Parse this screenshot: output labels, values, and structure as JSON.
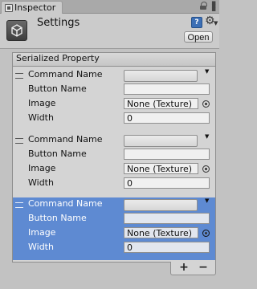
{
  "tab": {
    "title": "Inspector",
    "icon": "inspector-icon"
  },
  "header": {
    "title": "Settings",
    "icon": "settings-asset-icon",
    "help_icon": "help-icon",
    "help_glyph": "?",
    "gear_icon": "gear-icon",
    "open_button": "Open"
  },
  "list": {
    "header": "Serialized Property",
    "elements": [
      {
        "command_name_label": "Command Name",
        "button_name_label": "Button Name",
        "image_label": "Image",
        "image_value": "None (Texture)",
        "width_label": "Width",
        "width_value": "0",
        "selected": false
      },
      {
        "command_name_label": "Command Name",
        "button_name_label": "Button Name",
        "image_label": "Image",
        "image_value": "None (Texture)",
        "width_label": "Width",
        "width_value": "0",
        "selected": false
      },
      {
        "command_name_label": "Command Name",
        "button_name_label": "Button Name",
        "image_label": "Image",
        "image_value": "None (Texture)",
        "width_label": "Width",
        "width_value": "0",
        "selected": true
      }
    ],
    "add_label": "+",
    "remove_label": "−"
  },
  "colors": {
    "panel_bg": "#c2c2c2",
    "selection": "#5e8ad2",
    "help_icon": "#3c6fb5"
  }
}
